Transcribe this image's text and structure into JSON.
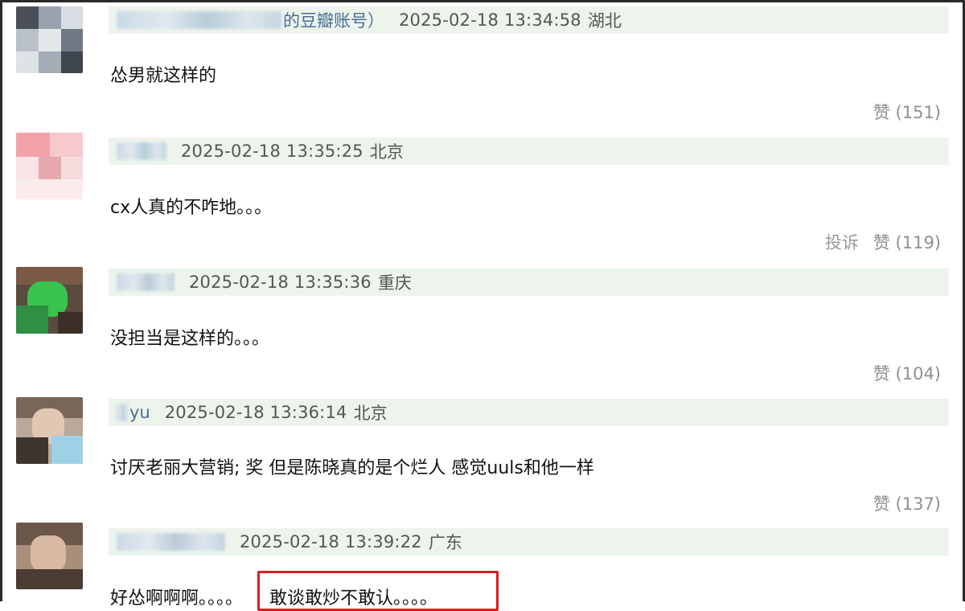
{
  "comments": [
    {
      "nickname_suffix": "的豆瓣账号）",
      "time": "2025-02-18 13:34:58",
      "location": "湖北",
      "text": "怂男就这样的",
      "report": "",
      "like_label": "赞",
      "like_count": "(151)"
    },
    {
      "nickname_suffix": "",
      "time": "2025-02-18 13:35:25",
      "location": "北京",
      "text": "cx人真的不咋地。。。",
      "report": "投诉",
      "like_label": "赞",
      "like_count": "(119)"
    },
    {
      "nickname_suffix": "",
      "time": "2025-02-18 13:35:36",
      "location": "重庆",
      "text": "没担当是这样的。。。",
      "report": "",
      "like_label": "赞",
      "like_count": "(104)"
    },
    {
      "nickname_suffix": "yu",
      "time": "2025-02-18 13:36:14",
      "location": "北京",
      "text": "讨厌老丽大营销; 奖 但是陈晓真的是个烂人 感觉uuls和他一样",
      "report": "",
      "like_label": "赞",
      "like_count": "(137)"
    },
    {
      "nickname_suffix": "",
      "time": "2025-02-18 13:39:22",
      "location": "广东",
      "text": "好怂啊啊啊。。。。",
      "highlight_text": "敢谈敢炒不敢认。。。。",
      "report": "",
      "like_label": "",
      "like_count": ""
    }
  ]
}
